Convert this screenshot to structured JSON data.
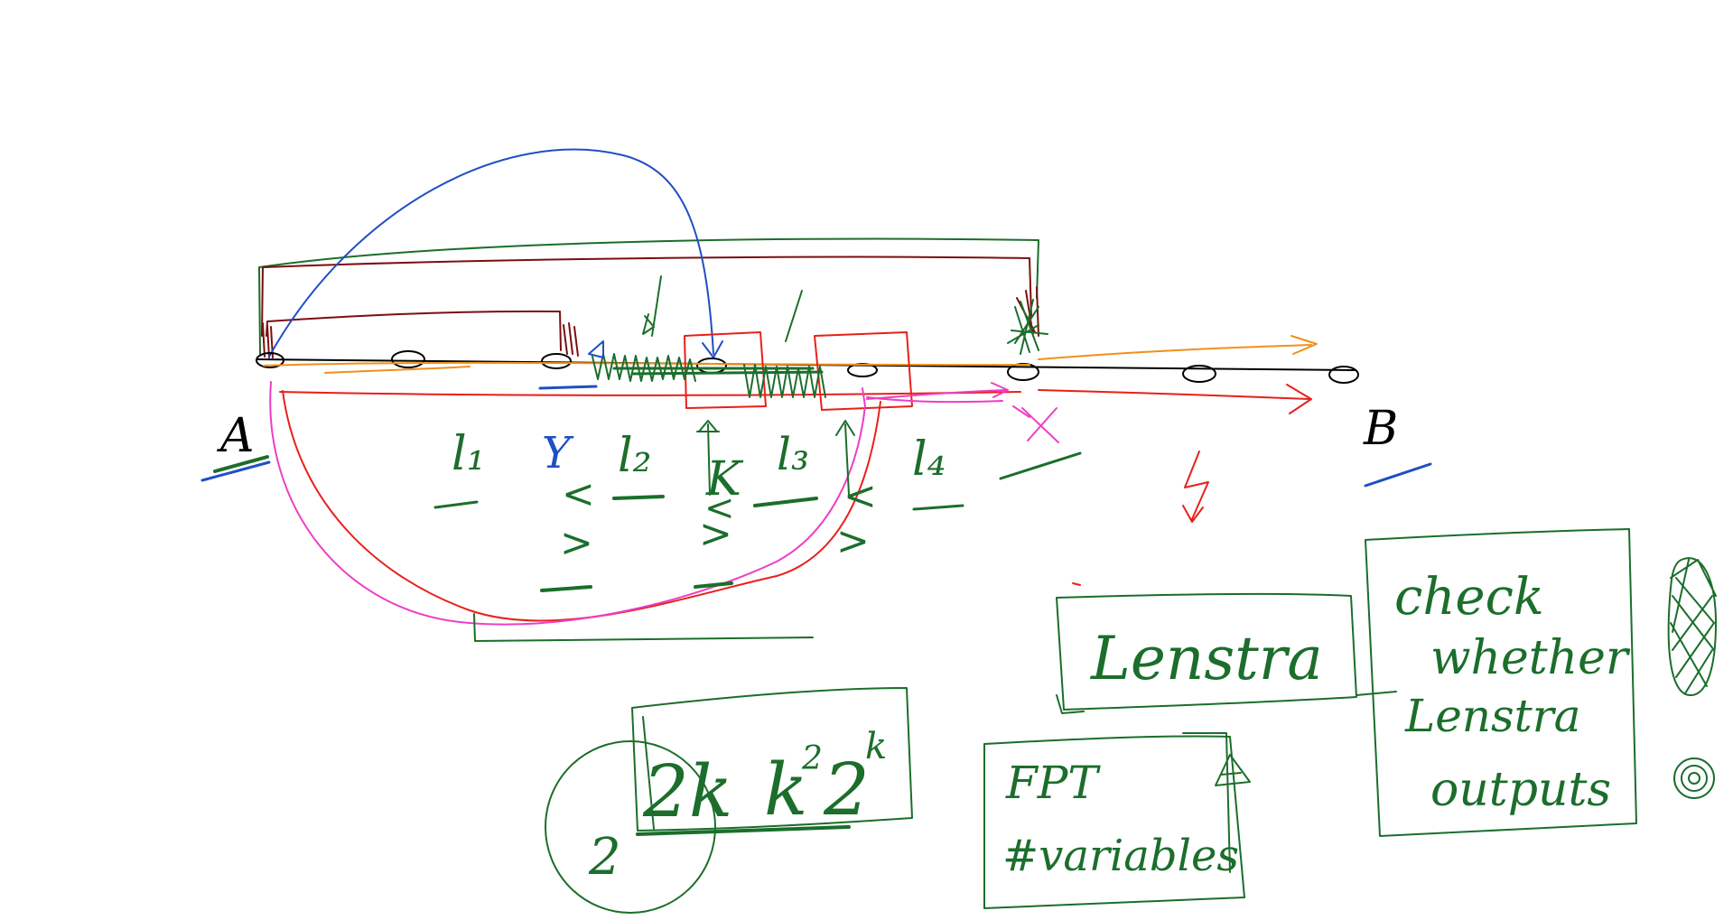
{
  "labels": {
    "point_a": "A",
    "point_b": "B",
    "segment_1": "l₁",
    "segment_2": "l₂",
    "segment_3": "l₃",
    "segment_4": "l₄",
    "y_marker": "Y",
    "k_marker": "K",
    "lt_1": "<",
    "gt_1": ">",
    "lt_2": "<",
    "gt_2": ">",
    "lt_3": "<",
    "gt_3": ">",
    "lightning": "↯"
  },
  "boxes": {
    "lenstra": "Lenstra",
    "check_line_1": "check",
    "check_line_2": "whether",
    "check_line_3": "Lenstra",
    "check_line_4": "outputs",
    "fpt_line_1": "FPT",
    "fpt_line_2": "#variables"
  },
  "complexity": {
    "prefix": "2",
    "term_1": "2k",
    "term_2_base": "k",
    "term_2_exp": "2",
    "term_3_base": "2",
    "term_3_exp": "k"
  },
  "colors": {
    "black": "#000000",
    "green": "#1b6e2b",
    "dark_red": "#7a0f0f",
    "blue": "#1f4fc4",
    "orange": "#f0901a",
    "red": "#e8201a",
    "pink": "#ee3ec5"
  }
}
